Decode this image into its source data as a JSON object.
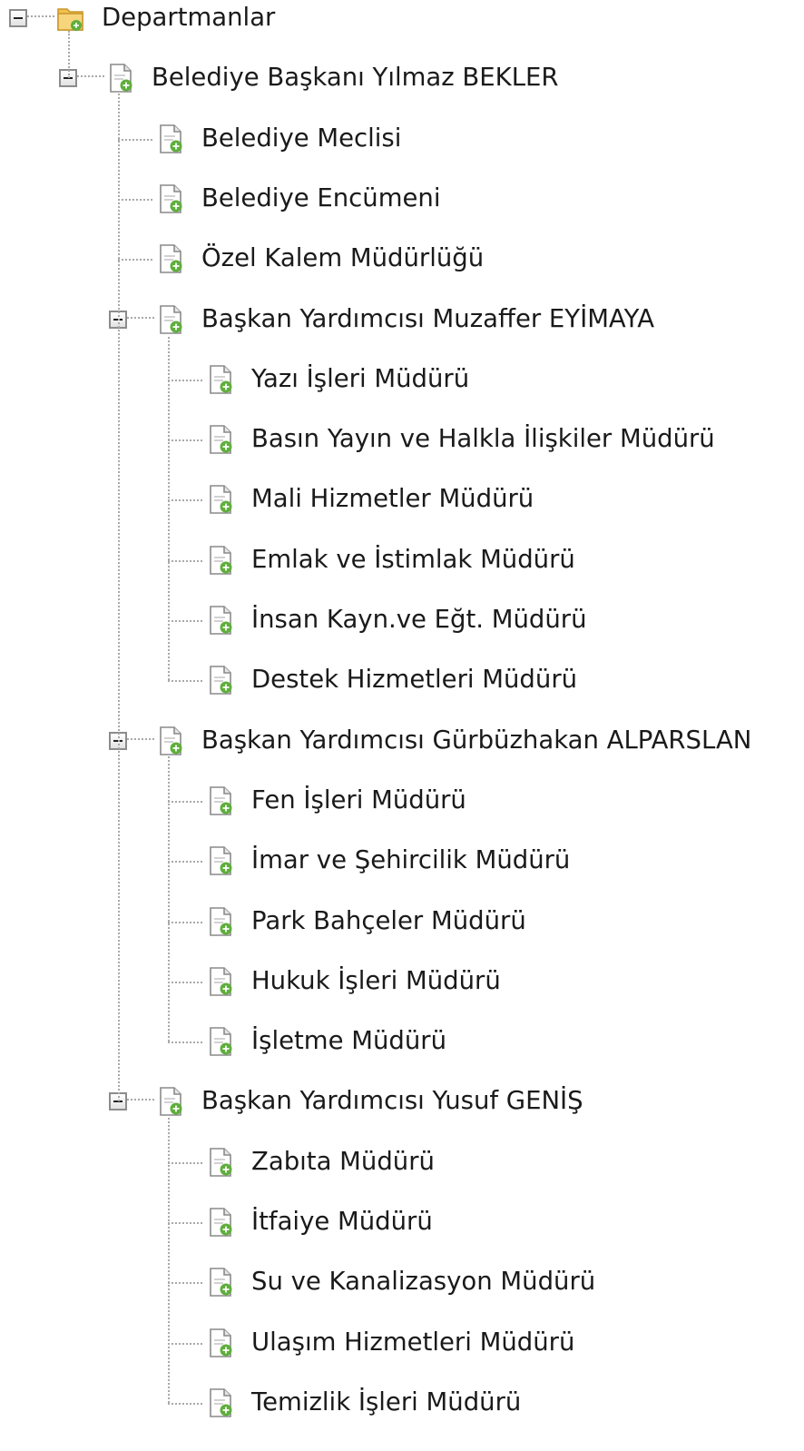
{
  "tree": {
    "root": {
      "label": "Departmanlar",
      "icon": "folder-icon",
      "expanded": true,
      "children": [
        {
          "label": "Belediye Başkanı Yılmaz BEKLER",
          "icon": "document-icon",
          "expanded": true,
          "children": [
            {
              "label": "Belediye Meclisi",
              "icon": "document-icon"
            },
            {
              "label": "Belediye Encümeni",
              "icon": "document-icon"
            },
            {
              "label": "Özel Kalem Müdürlüğü",
              "icon": "document-icon"
            },
            {
              "label": "Başkan Yardımcısı Muzaffer EYİMAYA",
              "icon": "document-icon",
              "expanded": true,
              "children": [
                {
                  "label": "Yazı İşleri Müdürü",
                  "icon": "document-icon"
                },
                {
                  "label": "Basın Yayın ve Halkla İlişkiler Müdürü",
                  "icon": "document-icon"
                },
                {
                  "label": "Mali Hizmetler Müdürü",
                  "icon": "document-icon"
                },
                {
                  "label": "Emlak ve İstimlak Müdürü",
                  "icon": "document-icon"
                },
                {
                  "label": "İnsan Kayn.ve Eğt. Müdürü",
                  "icon": "document-icon"
                },
                {
                  "label": "Destek Hizmetleri Müdürü",
                  "icon": "document-icon"
                }
              ]
            },
            {
              "label": "Başkan Yardımcısı Gürbüzhakan ALPARSLAN",
              "icon": "document-icon",
              "expanded": true,
              "children": [
                {
                  "label": "Fen İşleri Müdürü",
                  "icon": "document-icon"
                },
                {
                  "label": "İmar ve Şehircilik Müdürü",
                  "icon": "document-icon"
                },
                {
                  "label": "Park Bahçeler Müdürü",
                  "icon": "document-icon"
                },
                {
                  "label": "Hukuk İşleri Müdürü",
                  "icon": "document-icon"
                },
                {
                  "label": "İşletme Müdürü",
                  "icon": "document-icon"
                }
              ]
            },
            {
              "label": "Başkan Yardımcısı Yusuf GENİŞ",
              "icon": "document-icon",
              "expanded": true,
              "children": [
                {
                  "label": "Zabıta Müdürü",
                  "icon": "document-icon"
                },
                {
                  "label": "İtfaiye Müdürü",
                  "icon": "document-icon"
                },
                {
                  "label": "Su ve Kanalizasyon Müdürü",
                  "icon": "document-icon"
                },
                {
                  "label": "Ulaşım Hizmetleri Müdürü",
                  "icon": "document-icon"
                },
                {
                  "label": "Temizlik İşleri Müdürü",
                  "icon": "document-icon"
                }
              ]
            }
          ]
        }
      ]
    }
  },
  "colors": {
    "text": "#1a1a1a",
    "connector": "#a9a9a9",
    "expander_border": "#8c8c8c",
    "folder": "#f2c14e",
    "badge": "#5fae3c"
  }
}
